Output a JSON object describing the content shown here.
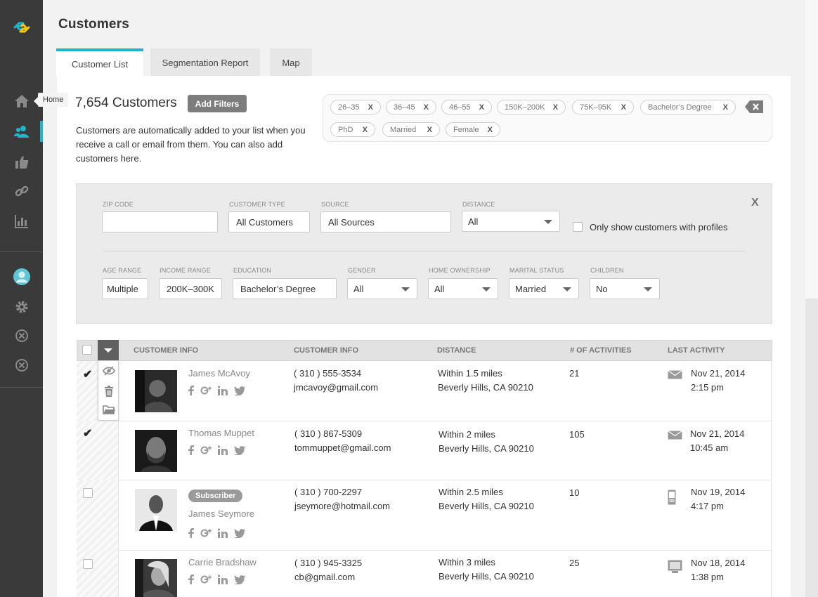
{
  "sidebar": {
    "tooltip": "Home",
    "nav": [
      "home-icon",
      "customers-icon",
      "thumbs-up-icon",
      "link-icon",
      "reports-icon"
    ],
    "bottom": [
      "avatar",
      "gear-icon",
      "close-circle-icon",
      "close-circle-icon"
    ],
    "accent": "#1fb6c9"
  },
  "page": {
    "title": "Customers"
  },
  "tabs": [
    "Customer List",
    "Segmentation Report",
    "Map"
  ],
  "summary": {
    "count": "7,654 Customers",
    "add_filters": "Add Filters",
    "description": "Customers are automatically added to your list when you receive a call or email from them. You can also add customers here."
  },
  "chips": [
    "26–35",
    "36–45",
    "46–55",
    "150K–200K",
    "75K–95K",
    "Bachelor’s Degree",
    "PhD",
    "Married",
    "Female"
  ],
  "chip_remove": "X",
  "filters": {
    "close": "X",
    "zip": {
      "label": "ZIP CODE",
      "value": ""
    },
    "customer_type": {
      "label": "CUSTOMER TYPE",
      "value": "All Customers"
    },
    "source": {
      "label": "SOURCE",
      "value": "All Sources"
    },
    "distance": {
      "label": "DISTANCE",
      "value": "All"
    },
    "profiles_only": "Only show customers with profiles",
    "age": {
      "label": "AGE RANGE",
      "value": "Multiple"
    },
    "income": {
      "label": "INCOME RANGE",
      "value": "200K–300K"
    },
    "education": {
      "label": "EDUCATION",
      "value": "Bachelor’s Degree"
    },
    "gender": {
      "label": "GENDER",
      "value": "All"
    },
    "home": {
      "label": "HOME OWNERSHIP",
      "value": "All"
    },
    "marital": {
      "label": "MARITAL STATUS",
      "value": "Married"
    },
    "children": {
      "label": "CHILDREN",
      "value": "No"
    }
  },
  "table": {
    "headers": [
      "CUSTOMER INFO",
      "CUSTOMER INFO",
      "DISTANCE",
      "# OF ACTIVITIES",
      "LAST ACTIVITY"
    ],
    "rows": [
      {
        "checked": true,
        "name": "James McAvoy",
        "badge": "",
        "phone": "( 310 ) 555-3534",
        "email": "jmcavoy@gmail.com",
        "distance": "Within 1.5 miles",
        "location": "Beverly Hills, CA 90210",
        "activities": "21",
        "activity_icon": "envelope-icon",
        "date": "Nov 21, 2014",
        "time": "2:15 pm"
      },
      {
        "checked": true,
        "name": "Thomas Muppet",
        "badge": "",
        "phone": "( 310 ) 867-5309",
        "email": "tommuppet@gmail.com",
        "distance": "Within 2 miles",
        "location": "Beverly Hills, CA 90210",
        "activities": "105",
        "activity_icon": "envelope-icon",
        "date": "Nov 21, 2014",
        "time": "10:45 am"
      },
      {
        "checked": false,
        "name": "James Seymore",
        "badge": "Subscriber",
        "phone": "( 310 ) 700-2297",
        "email": "jseymore@hotmail.com",
        "distance": "Within 2.5 miles",
        "location": "Beverly Hills, CA 90210",
        "activities": "10",
        "activity_icon": "mobile-phone-icon",
        "date": "Nov 19, 2014",
        "time": "4:17 pm"
      },
      {
        "checked": false,
        "name": "Carrie Bradshaw",
        "badge": "",
        "phone": "( 310 ) 945-3325",
        "email": "cb@gmail.com",
        "distance": "Within 3 miles",
        "location": "Beverly Hills, CA 90210",
        "activities": "25",
        "activity_icon": "monitor-icon",
        "date": "Nov 18, 2014",
        "time": "1:38 pm"
      }
    ],
    "row_actions": [
      "eye-icon",
      "trash-icon",
      "folder-icon"
    ]
  }
}
